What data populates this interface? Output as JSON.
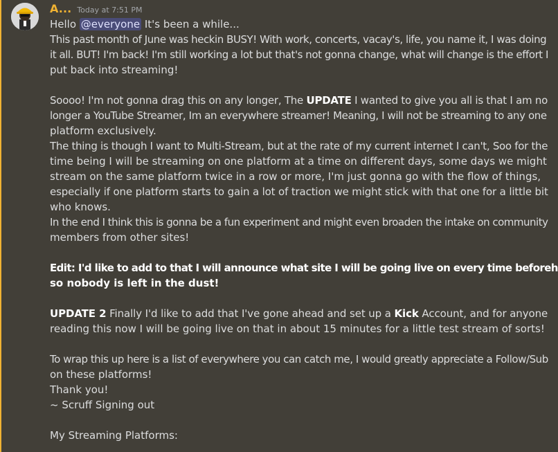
{
  "colors": {
    "background": "#423f38",
    "mention_bar": "#f0b232",
    "username": "#f0b232",
    "mention_bg": "#5865f2"
  },
  "message": {
    "author": "A...",
    "timestamp": "Today at 7:51 PM",
    "avatar_icon": "hardhat-avatar-icon",
    "greeting_pre": "Hello ",
    "mention": "@everyone",
    "greeting_post": " It's been a while...",
    "p1": [
      "This past month of June was heckin BUSY! With work, concerts, vacay's, life, you name it, I was doing",
      "it all. BUT! I'm back! I'm still working a lot but that's not gonna change, what will change is the effort I",
      "put back into streaming!"
    ],
    "p2_line1_pre": "Soooo! I'm not gonna drag this on any longer, The ",
    "p2_line1_bold": "UPDATE",
    "p2_line1_post": " I wanted to give you all is that I am no",
    "p2_rest": [
      "longer a YouTube Streamer, Im an everywhere streamer! Meaning, I will not be streaming to any one",
      "platform exclusively.",
      "The thing is though I want to Multi-Stream, but at the rate of my current internet I can't, Soo for the",
      "time being I will be streaming on one platform at a time on different days, some days we might",
      "stream on the same platform twice in a row or more, I'm just gonna go with the flow of things,",
      "especially if one platform starts to gain a lot of traction we might stick with that one for a little bit",
      "who knows.",
      "In the end I think this is gonna be a fun experiment and might even broaden the intake on community",
      "members from other sites!"
    ],
    "edit": [
      "Edit: I'd like to add to that I will announce what site I will be going live on every time beforehand",
      "so nobody is left in the dust!"
    ],
    "u2_bold": "UPDATE 2",
    "u2_mid": " Finally I'd like to add that I've gone ahead and set up a ",
    "u2_kick": "Kick",
    "u2_post": " Account, and for anyone",
    "u2_line2": "reading this now I will be going live on that in about 15 minutes for a little test stream of sorts!",
    "wrap": [
      "To wrap this up here is a list of everywhere you can catch me, I would greatly appreciate a Follow/Sub",
      "on these platforms!",
      "Thank you!",
      "~ Scruff Signing out"
    ],
    "platforms_heading": "My Streaming Platforms:"
  }
}
